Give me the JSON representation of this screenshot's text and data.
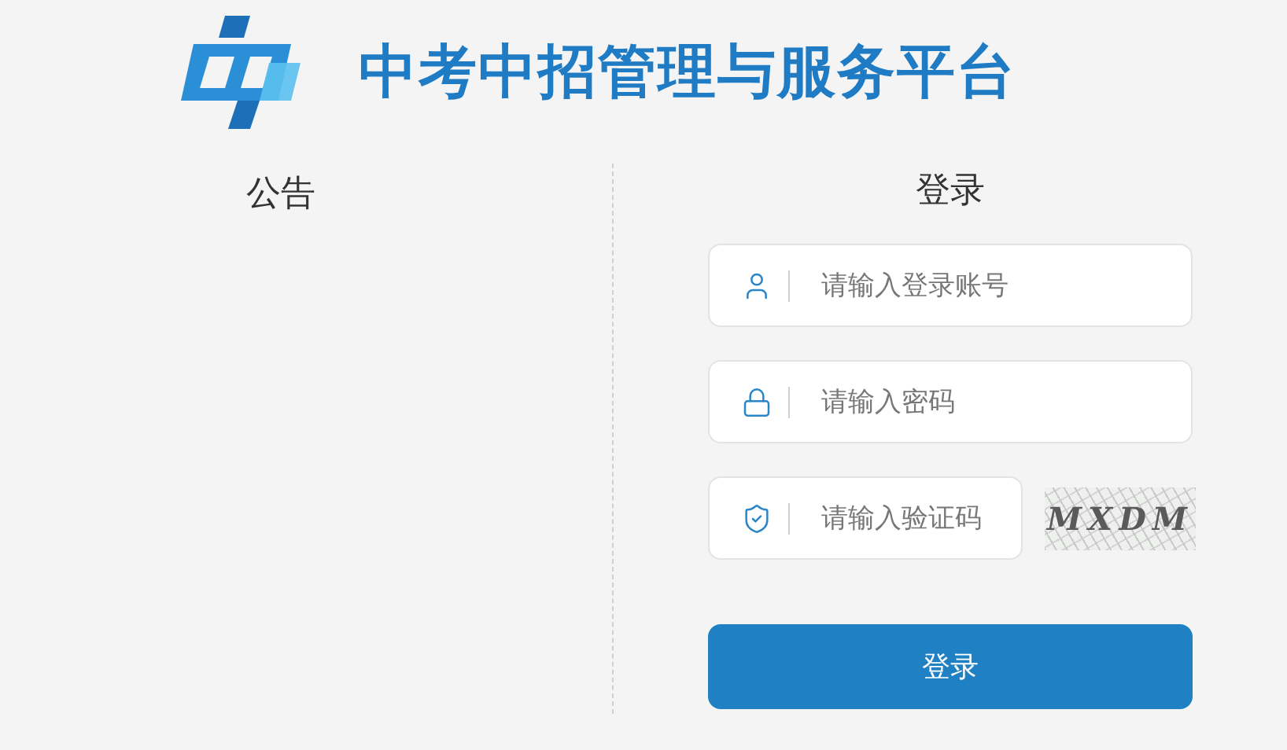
{
  "header": {
    "title": "中考中招管理与服务平台"
  },
  "notice": {
    "title": "公告"
  },
  "login": {
    "title": "登录",
    "fields": [
      {
        "kind": "user",
        "placeholder": "请输入登录账号"
      },
      {
        "kind": "password",
        "placeholder": "请输入密码"
      },
      {
        "kind": "captcha",
        "placeholder": "请输入验证码",
        "captcha_text": "MXDM"
      }
    ],
    "button": "登录"
  }
}
